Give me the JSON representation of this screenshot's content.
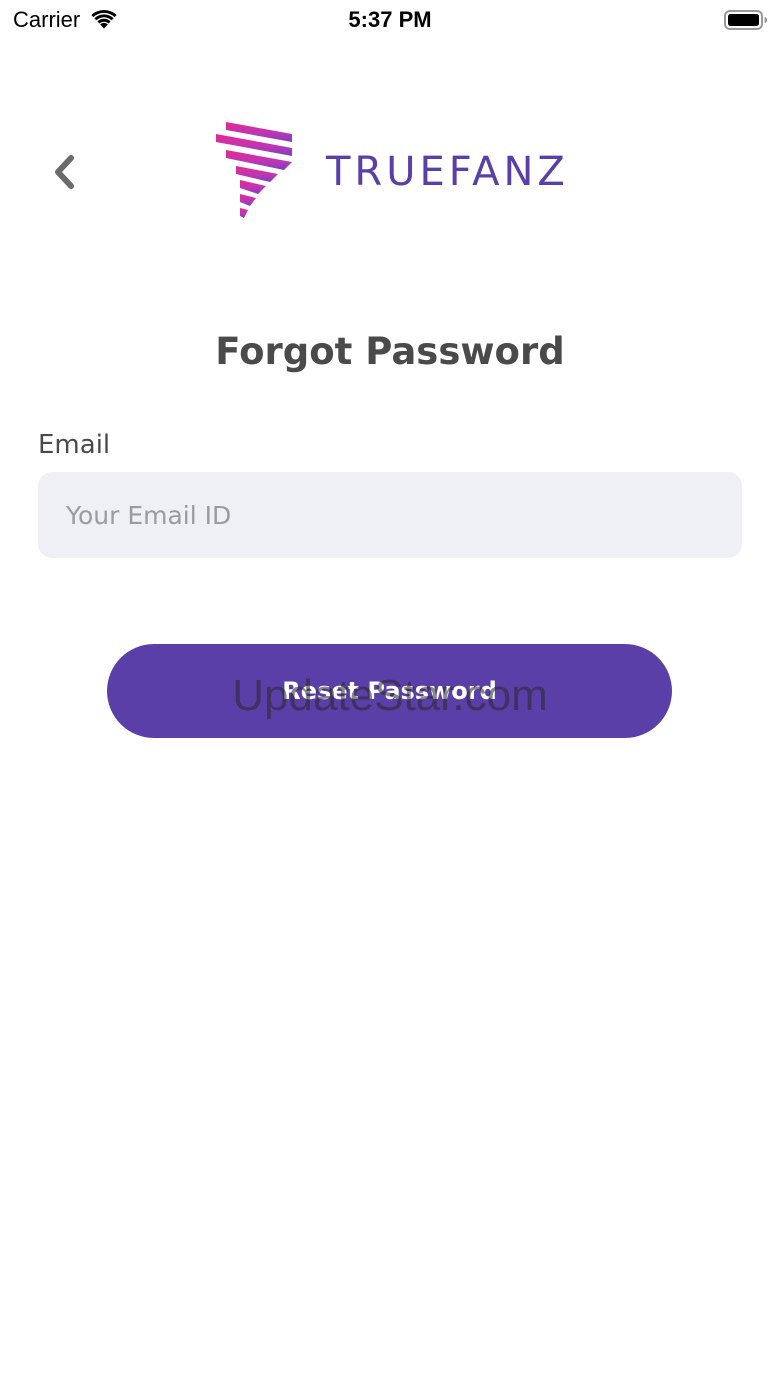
{
  "status_bar": {
    "carrier": "Carrier",
    "time": "5:37 PM",
    "wifi_icon": "wifi-icon",
    "battery_icon": "battery-icon"
  },
  "header": {
    "back_icon": "chevron-left-icon",
    "logo_text": "TRUEFANZ"
  },
  "page": {
    "title": "Forgot Password"
  },
  "form": {
    "email_label": "Email",
    "email_value": "",
    "email_placeholder": "Your Email ID",
    "submit_label": "Reset Password"
  },
  "watermark": "UpdateStar.com",
  "colors": {
    "brand_purple": "#5b3fa8",
    "logo_pink": "#e02c8f",
    "input_bg": "#eff0f5",
    "title_text": "#4a4a4a"
  }
}
